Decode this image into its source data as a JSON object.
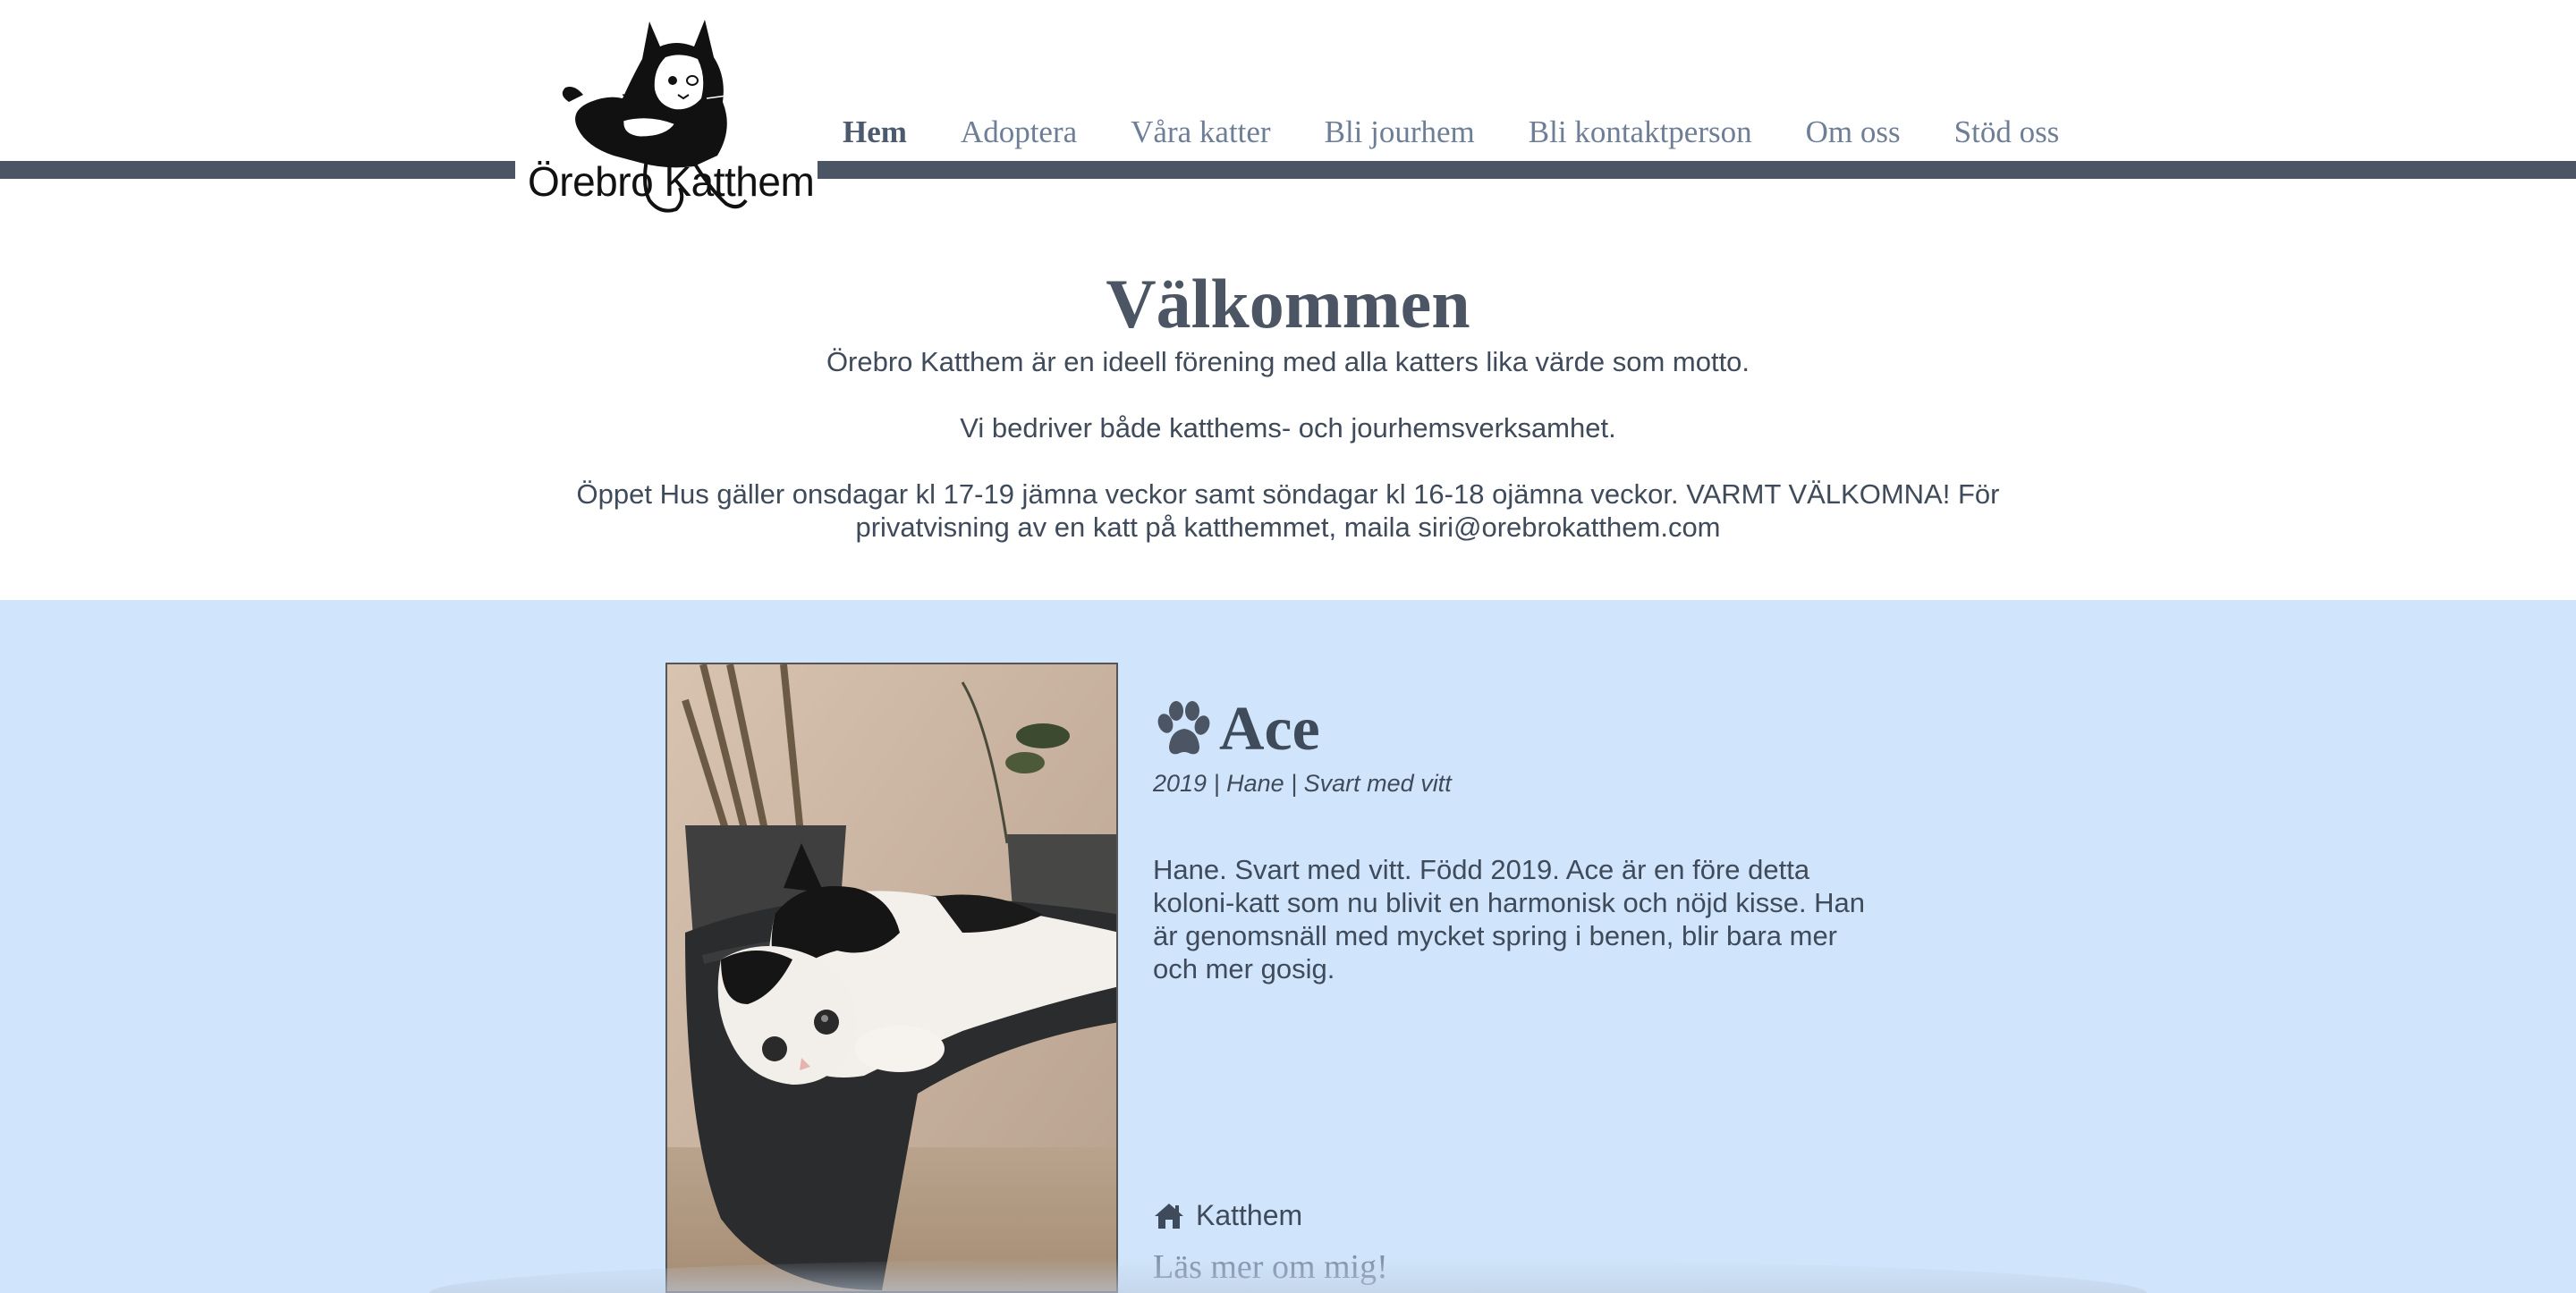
{
  "logo": {
    "text": "Örebro Katthem"
  },
  "nav": {
    "items": [
      {
        "label": "Hem",
        "active": true
      },
      {
        "label": "Adoptera",
        "active": false
      },
      {
        "label": "Våra katter",
        "active": false
      },
      {
        "label": "Bli jourhem",
        "active": false
      },
      {
        "label": "Bli kontaktperson",
        "active": false
      },
      {
        "label": "Om oss",
        "active": false
      },
      {
        "label": "Stöd oss",
        "active": false
      }
    ]
  },
  "welcome": {
    "title": "Välkommen",
    "paragraph1": "Örebro Katthem är en ideell förening med alla katters lika värde som motto.",
    "paragraph2": "Vi bedriver både katthems- och jourhemsverksamhet.",
    "paragraph3": "Öppet Hus gäller onsdagar kl 17-19 jämna veckor samt söndagar kl 16-18 ojämna veckor. VARMT VÄLKOMNA! För privatvisning av en katt på katthemmet, maila siri@orebrokatthem.com"
  },
  "cat": {
    "name": "Ace",
    "meta": "2019 | Hane | Svart med vitt",
    "description": "Hane. Svart med vitt. Född 2019. Ace är en före detta koloni-katt som nu blivit en harmonisk och nöjd kisse. Han är genomsnäll med mycket spring i benen, blir bara mer och mer gosig.",
    "location": "Katthem",
    "read_more": "Läs mer om mig!",
    "icons": {
      "name": "paw-icon",
      "location": "home-icon"
    }
  },
  "colors": {
    "nav_bar": "#4b5563",
    "section_bg": "#d0e5fb",
    "heading": "#4b5563",
    "link": "#8092aa"
  }
}
